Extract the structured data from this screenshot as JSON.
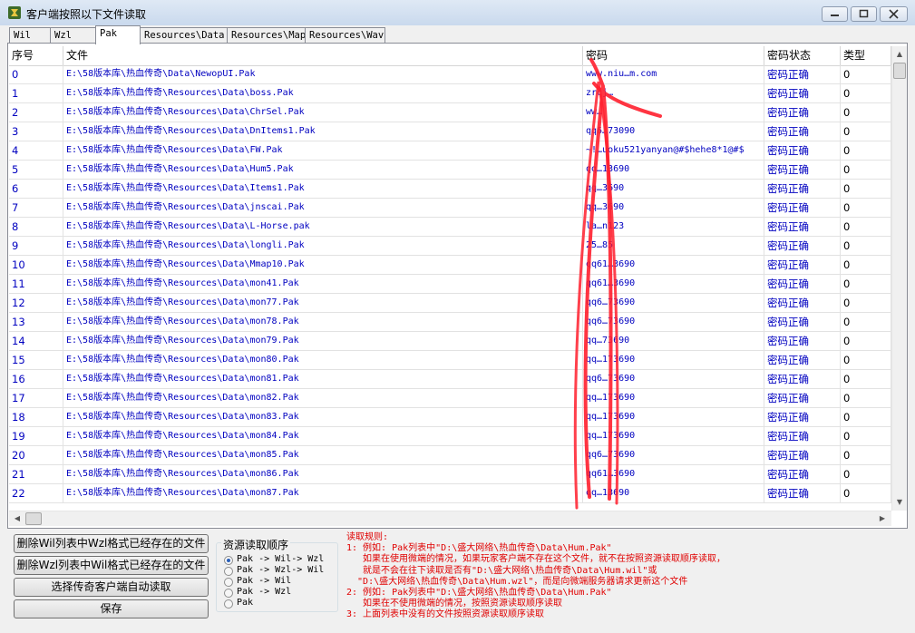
{
  "window": {
    "title": "客户端按照以下文件读取"
  },
  "tabs": [
    "Wil",
    "Wzl",
    "Pak",
    "Resources\\Data",
    "Resources\\Map",
    "Resources\\Wav"
  ],
  "active_tab": "Pak",
  "table": {
    "columns": [
      "序号",
      "文件",
      "密码",
      "密码状态",
      "类型"
    ],
    "rows": [
      [
        "0",
        "E:\\58版本库\\热血传奇\\Data\\NewopUI.Pak",
        "www.niu…m.com",
        "密码正确",
        "0"
      ],
      [
        "1",
        "E:\\58版本库\\热血传奇\\Resources\\Data\\boss.Pak",
        "zrcj…",
        "密码正确",
        "0"
      ],
      [
        "2",
        "E:\\58版本库\\热血传奇\\Resources\\Data\\ChrSel.Pak",
        "ww…",
        "密码正确",
        "0"
      ],
      [
        "3",
        "E:\\58版本库\\热血传奇\\Resources\\Data\\DnItems1.Pak",
        "qq6…73090",
        "密码正确",
        "0"
      ],
      [
        "4",
        "E:\\58版本库\\热血传奇\\Resources\\Data\\FW.Pak",
        "~!…uoku521yanyan@#$hehe8*1@#$",
        "密码正确",
        "0"
      ],
      [
        "5",
        "E:\\58版本库\\热血传奇\\Resources\\Data\\Hum5.Pak",
        "qq…13690",
        "密码正确",
        "0"
      ],
      [
        "6",
        "E:\\58版本库\\热血传奇\\Resources\\Data\\Items1.Pak",
        "qq…3690",
        "密码正确",
        "0"
      ],
      [
        "7",
        "E:\\58版本库\\热血传奇\\Resources\\Data\\jnscai.Pak",
        "qq…3690",
        "密码正确",
        "0"
      ],
      [
        "8",
        "E:\\58版本库\\热血传奇\\Resources\\Data\\L-Horse.pak",
        "la…n123",
        "密码正确",
        "0"
      ],
      [
        "9",
        "E:\\58版本库\\热血传奇\\Resources\\Data\\longli.Pak",
        "25…85",
        "密码正确",
        "0"
      ],
      [
        "10",
        "E:\\58版本库\\热血传奇\\Resources\\Data\\Mmap10.Pak",
        "qq61…3690",
        "密码正确",
        "0"
      ],
      [
        "11",
        "E:\\58版本库\\热血传奇\\Resources\\Data\\mon41.Pak",
        "qq61…3690",
        "密码正确",
        "0"
      ],
      [
        "12",
        "E:\\58版本库\\热血传奇\\Resources\\Data\\mon77.Pak",
        "qq6…73690",
        "密码正确",
        "0"
      ],
      [
        "13",
        "E:\\58版本库\\热血传奇\\Resources\\Data\\mon78.Pak",
        "qq6…73690",
        "密码正确",
        "0"
      ],
      [
        "14",
        "E:\\58版本库\\热血传奇\\Resources\\Data\\mon79.Pak",
        "qq…73690",
        "密码正确",
        "0"
      ],
      [
        "15",
        "E:\\58版本库\\热血传奇\\Resources\\Data\\mon80.Pak",
        "qq…173690",
        "密码正确",
        "0"
      ],
      [
        "16",
        "E:\\58版本库\\热血传奇\\Resources\\Data\\mon81.Pak",
        "qq6…73690",
        "密码正确",
        "0"
      ],
      [
        "17",
        "E:\\58版本库\\热血传奇\\Resources\\Data\\mon82.Pak",
        "qq…173690",
        "密码正确",
        "0"
      ],
      [
        "18",
        "E:\\58版本库\\热血传奇\\Resources\\Data\\mon83.Pak",
        "qq…173690",
        "密码正确",
        "0"
      ],
      [
        "19",
        "E:\\58版本库\\热血传奇\\Resources\\Data\\mon84.Pak",
        "qq…173690",
        "密码正确",
        "0"
      ],
      [
        "20",
        "E:\\58版本库\\热血传奇\\Resources\\Data\\mon85.Pak",
        "qq6…73690",
        "密码正确",
        "0"
      ],
      [
        "21",
        "E:\\58版本库\\热血传奇\\Resources\\Data\\mon86.Pak",
        "qq61…3690",
        "密码正确",
        "0"
      ],
      [
        "22",
        "E:\\58版本库\\热血传奇\\Resources\\Data\\mon87.Pak",
        "qq…13690",
        "密码正确",
        "0"
      ]
    ]
  },
  "buttons": {
    "delete_wil": "删除Wil列表中Wzl格式已经存在的文件",
    "delete_wzl": "删除Wzl列表中Wil格式已经存在的文件",
    "select_client": "选择传奇客户端自动读取",
    "save": "保存"
  },
  "resource_order": {
    "title": "资源读取顺序",
    "options": [
      "Pak -> Wil-> Wzl",
      "Pak -> Wzl-> Wil",
      "Pak -> Wil",
      "Pak -> Wzl",
      "Pak"
    ],
    "selected_index": 0
  },
  "rules": {
    "lines": [
      "读取规则:",
      "1: 例如: Pak列表中\"D:\\盛大网络\\热血传奇\\Data\\Hum.Pak\"",
      "   如果在使用微端的情况，如果玩家客户端不存在这个文件，就不在按照资源读取顺序读取，",
      "   就是不会在往下读取是否有\"D:\\盛大网络\\热血传奇\\Data\\Hum.wil\"或",
      "  \"D:\\盛大网络\\热血传奇\\Data\\Hum.wzl\"，而是向微端服务器请求更新这个文件",
      "2: 例如: Pak列表中\"D:\\盛大网络\\热血传奇\\Data\\Hum.Pak\"",
      "   如果在不使用微端的情况，按照资源读取顺序读取",
      "3: 上面列表中没有的文件按照资源读取顺序读取"
    ]
  },
  "colors": {
    "cell_text": "#0000c0",
    "rule_text": "#e00000",
    "annotation_arrow": "#ff1f2d"
  },
  "icons": [
    "app-icon",
    "minimize-icon",
    "maximize-icon",
    "close-icon",
    "scroll-up-icon",
    "scroll-down-icon",
    "scroll-left-icon",
    "scroll-right-icon"
  ]
}
